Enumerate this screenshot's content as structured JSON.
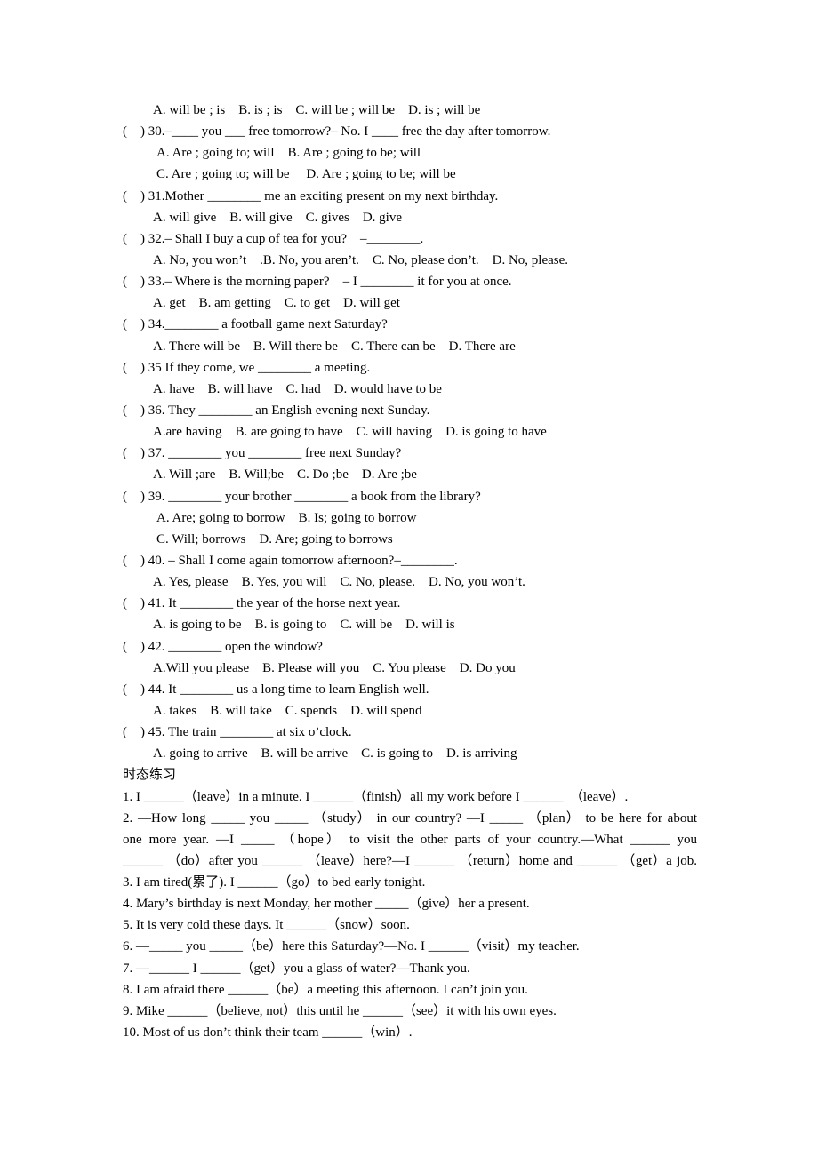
{
  "lines": [
    {
      "kind": "o",
      "text": "A. will be ; is    B. is ; is    C. will be ; will be    D. is ; will be"
    },
    {
      "kind": "q",
      "text": "(    ) 30.–____ you ___ free tomorrow?– No. I ____ free the day after tomorrow."
    },
    {
      "kind": "o2",
      "text": "A. Are ; going to; will    B. Are ; going to be; will"
    },
    {
      "kind": "o2",
      "text": "C. Are ; going to; will be     D. Are ; going to be; will be"
    },
    {
      "kind": "q",
      "text": "(    ) 31.Mother ________ me an exciting present on my next birthday."
    },
    {
      "kind": "o",
      "text": "A. will give    B. will give    C. gives    D. give"
    },
    {
      "kind": "q",
      "text": "(    ) 32.– Shall I buy a cup of tea for you?    –________."
    },
    {
      "kind": "o",
      "text": "A. No, you won’t    .B. No, you aren’t.    C. No, please don’t.    D. No, please."
    },
    {
      "kind": "q",
      "text": "(    ) 33.– Where is the morning paper?    – I ________ it for you at once."
    },
    {
      "kind": "o",
      "text": "A. get    B. am getting    C. to get    D. will get"
    },
    {
      "kind": "q",
      "text": "(    ) 34.________ a football game next Saturday?"
    },
    {
      "kind": "o",
      "text": "A. There will be    B. Will there be    C. There can be    D. There are"
    },
    {
      "kind": "q",
      "text": "(    ) 35 If they come, we ________ a meeting."
    },
    {
      "kind": "o",
      "text": "A. have    B. will have    C. had    D. would have to be"
    },
    {
      "kind": "q",
      "text": "(    ) 36. They ________ an English evening next Sunday."
    },
    {
      "kind": "o",
      "text": "A.are having    B. are going to have    C. will having    D. is going to have"
    },
    {
      "kind": "q",
      "text": "(    ) 37. ________ you ________ free next Sunday?"
    },
    {
      "kind": "o",
      "text": "A. Will ;are    B. Will;be    C. Do ;be    D. Are ;be"
    },
    {
      "kind": "q",
      "text": "(    ) 39. ________ your brother ________ a book from the library?"
    },
    {
      "kind": "o2",
      "text": "A. Are; going to borrow    B. Is; going to borrow"
    },
    {
      "kind": "o2",
      "text": "C. Will; borrows    D. Are; going to borrows"
    },
    {
      "kind": "q",
      "text": "(    ) 40. – Shall I come again tomorrow afternoon?–________."
    },
    {
      "kind": "o",
      "text": "A. Yes, please    B. Yes, you will    C. No, please.    D. No, you won’t."
    },
    {
      "kind": "q",
      "text": "(    ) 41. It ________ the year of the horse next year."
    },
    {
      "kind": "o",
      "text": "A. is going to be    B. is going to    C. will be    D. will is"
    },
    {
      "kind": "q",
      "text": "(    ) 42. ________ open the window?"
    },
    {
      "kind": "o",
      "text": "A.Will you please    B. Please will you    C. You please    D. Do you"
    },
    {
      "kind": "q",
      "text": "(    ) 44. It ________ us a long time to learn English well."
    },
    {
      "kind": "o",
      "text": "A. takes    B. will take    C. spends    D. will spend"
    },
    {
      "kind": "q",
      "text": "(    ) 45. The train ________ at six o’clock."
    },
    {
      "kind": "o",
      "text": "A. going to arrive    B. will be arrive    C. is going to    D. is arriving"
    },
    {
      "kind": "p",
      "text": "时态练习"
    },
    {
      "kind": "p",
      "text": "1. I ______（leave）in a minute. I ______（finish）all my work before I ______  （leave）."
    },
    {
      "kind": "j",
      "text": "2. —How long _____ you _____ （study） in our country? —I _____ （plan） to be here for about"
    },
    {
      "kind": "j",
      "text": "one more year. —I _____ （hope） to visit the other parts of your country.—What ______ you"
    },
    {
      "kind": "j",
      "text": "______ （do）after you ______ （leave）here?—I ______ （return）home and ______ （get）a job."
    },
    {
      "kind": "p",
      "text": "3. I am tired(累了). I ______（go）to bed early tonight."
    },
    {
      "kind": "p",
      "text": "4. Mary’s birthday is next Monday, her mother _____（give）her a present."
    },
    {
      "kind": "p",
      "text": "5. It is very cold these days. It ______（snow）soon."
    },
    {
      "kind": "p",
      "text": "6. —_____ you _____（be）here this Saturday?—No. I ______（visit）my teacher."
    },
    {
      "kind": "p",
      "text": "7. —______ I ______（get）you a glass of water?—Thank you."
    },
    {
      "kind": "p",
      "text": "8. I am afraid there ______（be）a meeting this afternoon. I can’t join you."
    },
    {
      "kind": "p",
      "text": "9. Mike ______（believe, not）this until he ______（see）it with his own eyes."
    },
    {
      "kind": "p",
      "text": "10. Most of us don’t think their team ______（win）."
    }
  ]
}
